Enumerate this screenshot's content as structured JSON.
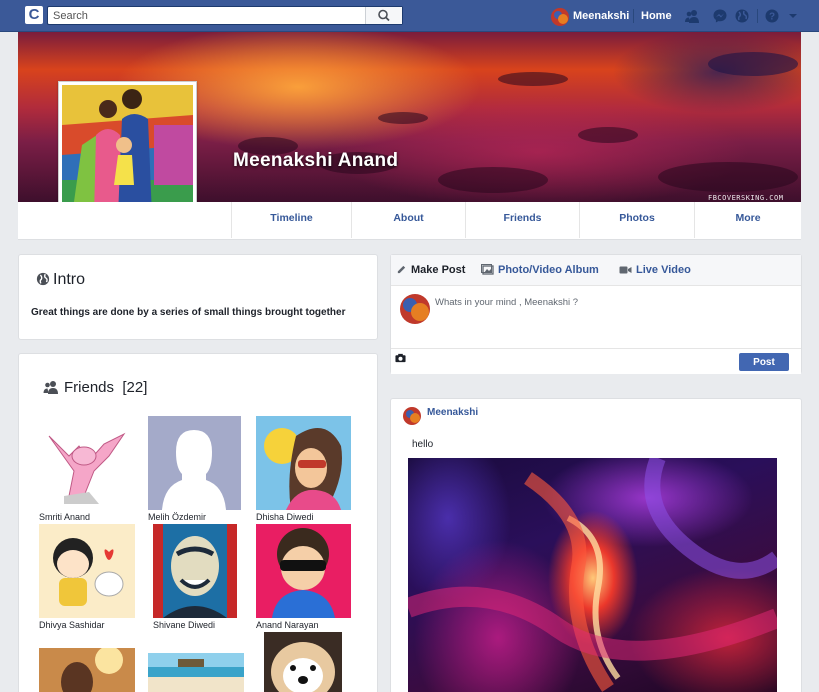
{
  "topbar": {
    "search_placeholder": "Search",
    "logo_letter": "C",
    "user_name": "Meenakshi",
    "home_label": "Home",
    "icons": [
      "friends-icon",
      "messenger-icon",
      "globe-icon",
      "help-icon",
      "dropdown-icon"
    ]
  },
  "profile": {
    "name": "Meenakshi Anand",
    "cover_credit": "FBCOVERSKING.COM"
  },
  "nav": {
    "tabs": [
      "Timeline",
      "About",
      "Friends",
      "Photos",
      "More"
    ]
  },
  "intro": {
    "title": "Intro",
    "bio": "Great things are done by a series of small things brought together"
  },
  "friends": {
    "title": "Friends",
    "count": "[22]",
    "list": [
      {
        "name": "Smriti Anand"
      },
      {
        "name": "Melih Özdemir"
      },
      {
        "name": "Dhisha Diwedi"
      },
      {
        "name": "Dhivya Sashidar"
      },
      {
        "name": "Shivane Diwedi"
      },
      {
        "name": "Anand Narayan"
      }
    ]
  },
  "composer": {
    "tabs": [
      "Make Post",
      "Photo/Video Album",
      "Live Video"
    ],
    "placeholder": "Whats in your mind , Meenakshi ?",
    "post_button": "Post"
  },
  "feed": {
    "posts": [
      {
        "author": "Meenakshi",
        "text": "hello"
      }
    ]
  },
  "colors": {
    "brand": "#3b5998",
    "link": "#365899",
    "button": "#4267b2",
    "background": "#e9ebee"
  }
}
